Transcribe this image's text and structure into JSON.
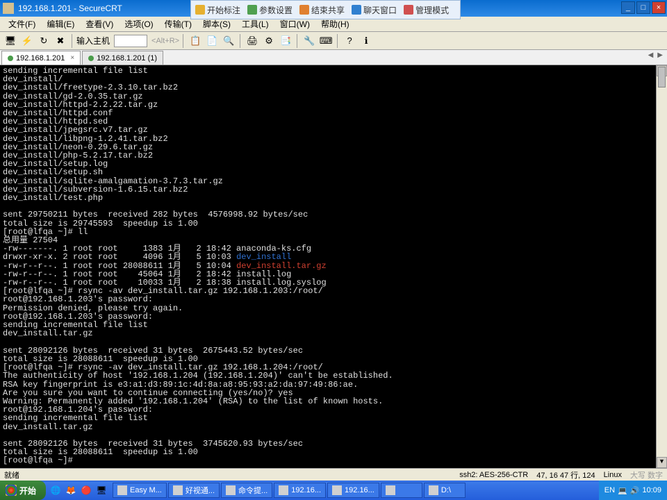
{
  "title": "192.168.1.201 - SecureCRT",
  "float_toolbar": [
    {
      "icon": "#e6b030",
      "label": "开始标注"
    },
    {
      "icon": "#50a050",
      "label": "参数设置"
    },
    {
      "icon": "#e08030",
      "label": "结束共享"
    },
    {
      "icon": "#3080d0",
      "label": "聊天窗口"
    },
    {
      "icon": "#d05050",
      "label": "管理模式"
    }
  ],
  "menu": [
    "文件(F)",
    "编辑(E)",
    "查看(V)",
    "选项(O)",
    "传输(T)",
    "脚本(S)",
    "工具(L)",
    "窗口(W)",
    "帮助(H)"
  ],
  "host_label": "输入主机",
  "host_hint": "<Alt+R>",
  "tabs": [
    {
      "label": "192.168.1.201",
      "active": true,
      "closable": true
    },
    {
      "label": "192.168.1.201 (1)",
      "active": false,
      "closable": false
    }
  ],
  "terminal_lines": [
    {
      "t": "sending incremental file list"
    },
    {
      "t": "dev_install/"
    },
    {
      "t": "dev_install/freetype-2.3.10.tar.bz2"
    },
    {
      "t": "dev_install/gd-2.0.35.tar.gz"
    },
    {
      "t": "dev_install/httpd-2.2.22.tar.gz"
    },
    {
      "t": "dev_install/httpd.conf"
    },
    {
      "t": "dev_install/httpd.sed"
    },
    {
      "t": "dev_install/jpegsrc.v7.tar.gz"
    },
    {
      "t": "dev_install/libpng-1.2.41.tar.bz2"
    },
    {
      "t": "dev_install/neon-0.29.6.tar.gz"
    },
    {
      "t": "dev_install/php-5.2.17.tar.bz2"
    },
    {
      "t": "dev_install/setup.log"
    },
    {
      "t": "dev_install/setup.sh"
    },
    {
      "t": "dev_install/sqlite-amalgamation-3.7.3.tar.gz"
    },
    {
      "t": "dev_install/subversion-1.6.15.tar.bz2"
    },
    {
      "t": "dev_install/test.php"
    },
    {
      "t": ""
    },
    {
      "t": "sent 29750211 bytes  received 282 bytes  4576998.92 bytes/sec"
    },
    {
      "t": "total size is 29745593  speedup is 1.00"
    },
    {
      "t": "[root@lfqa ~]# ll"
    },
    {
      "t": "总用量 27504"
    },
    {
      "t": "-rw-------. 1 root root     1383 1月   2 18:42 anaconda-ks.cfg"
    },
    {
      "segs": [
        {
          "t": "drwxr-xr-x. 2 root root     4096 1月   5 10:03 "
        },
        {
          "t": "dev_install",
          "cls": "blue"
        }
      ]
    },
    {
      "segs": [
        {
          "t": "-rw-r--r--. 1 root root 28088611 1月   5 10:04 "
        },
        {
          "t": "dev_install.tar.gz",
          "cls": "red"
        }
      ]
    },
    {
      "t": "-rw-r--r--. 1 root root    45064 1月   2 18:42 install.log"
    },
    {
      "t": "-rw-r--r--. 1 root root    10033 1月   2 18:38 install.log.syslog"
    },
    {
      "t": "[root@lfqa ~]# rsync -av dev_install.tar.gz 192.168.1.203:/root/"
    },
    {
      "t": "root@192.168.1.203's password:"
    },
    {
      "t": "Permission denied, please try again."
    },
    {
      "t": "root@192.168.1.203's password:"
    },
    {
      "t": "sending incremental file list"
    },
    {
      "t": "dev_install.tar.gz"
    },
    {
      "t": ""
    },
    {
      "t": "sent 28092126 bytes  received 31 bytes  2675443.52 bytes/sec"
    },
    {
      "t": "total size is 28088611  speedup is 1.00"
    },
    {
      "t": "[root@lfqa ~]# rsync -av dev_install.tar.gz 192.168.1.204:/root/"
    },
    {
      "t": "The authenticity of host '192.168.1.204 (192.168.1.204)' can't be established."
    },
    {
      "t": "RSA key fingerprint is e3:a1:d3:89:1c:4d:8a:a8:95:93:a2:da:97:49:86:ae."
    },
    {
      "t": "Are you sure you want to continue connecting (yes/no)? yes"
    },
    {
      "t": "Warning: Permanently added '192.168.1.204' (RSA) to the list of known hosts."
    },
    {
      "t": "root@192.168.1.204's password:"
    },
    {
      "t": "sending incremental file list"
    },
    {
      "t": "dev_install.tar.gz"
    },
    {
      "t": ""
    },
    {
      "t": "sent 28092126 bytes  received 31 bytes  3745620.93 bytes/sec"
    },
    {
      "t": "total size is 28088611  speedup is 1.00"
    },
    {
      "t": "[root@lfqa ~]# "
    }
  ],
  "status": {
    "left": "就绪",
    "proto": "ssh2: AES-256-CTR",
    "pos": "47,  16 47 行, 124",
    "os": "Linux",
    "caps": "大写 数字"
  },
  "taskbar": {
    "start": "开始",
    "items": [
      "Easy M...",
      "好视通...",
      "命令提...",
      "192.16...",
      "192.16...",
      "",
      "D:\\"
    ],
    "lang": "EN",
    "time": "10:09"
  }
}
